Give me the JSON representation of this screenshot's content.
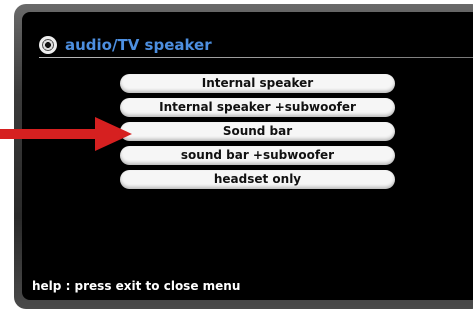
{
  "menu": {
    "title": "audio/TV speaker",
    "icon": "speaker-icon",
    "items": [
      {
        "label": "Internal speaker"
      },
      {
        "label": "Internal speaker +subwoofer"
      },
      {
        "label": "Sound bar"
      },
      {
        "label": "sound bar +subwoofer"
      },
      {
        "label": "headset only"
      }
    ],
    "highlighted_item": "Sound bar",
    "title_color": "#4d8fe0"
  },
  "footer": {
    "help_text": "help : press exit to close menu"
  },
  "annotation": {
    "arrow_color": "#d62020",
    "icon": "arrow-right-icon"
  }
}
